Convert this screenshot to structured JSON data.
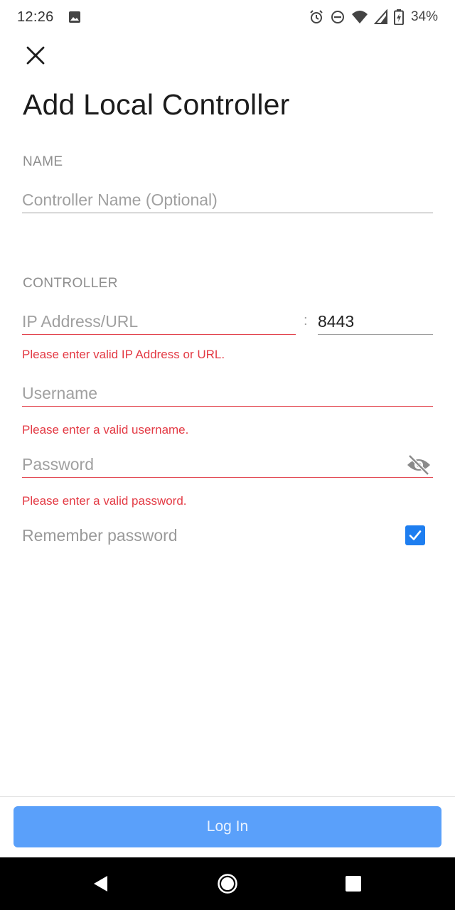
{
  "status_bar": {
    "time": "12:26",
    "battery_text": "34%",
    "icons": [
      "image-icon",
      "alarm-icon",
      "dnd-icon",
      "wifi-icon",
      "signal-icon",
      "battery-icon"
    ]
  },
  "header": {
    "close_icon": "close-icon",
    "title": "Add Local Controller"
  },
  "name_section": {
    "label": "NAME",
    "name_field": {
      "placeholder": "Controller Name (Optional)",
      "value": ""
    }
  },
  "controller_section": {
    "label": "CONTROLLER",
    "ip_field": {
      "placeholder": "IP Address/URL",
      "value": ""
    },
    "port_separator": ":",
    "port_field": {
      "placeholder": "",
      "value": "8443"
    },
    "ip_error": "Please enter valid IP Address or URL.",
    "username_field": {
      "placeholder": "Username",
      "value": ""
    },
    "username_error": "Please enter a valid username.",
    "password_field": {
      "placeholder": "Password",
      "value": ""
    },
    "password_toggle_icon": "eye-off-icon",
    "password_error": "Please enter a valid password.",
    "remember": {
      "label": "Remember password",
      "checked": true
    }
  },
  "footer": {
    "login_label": "Log In"
  },
  "nav_bar": {
    "icons": [
      "back-icon",
      "home-icon",
      "recents-icon"
    ]
  },
  "colors": {
    "error": "#e33a44",
    "accent": "#1e7ef0",
    "button": "#5aa0fa"
  }
}
